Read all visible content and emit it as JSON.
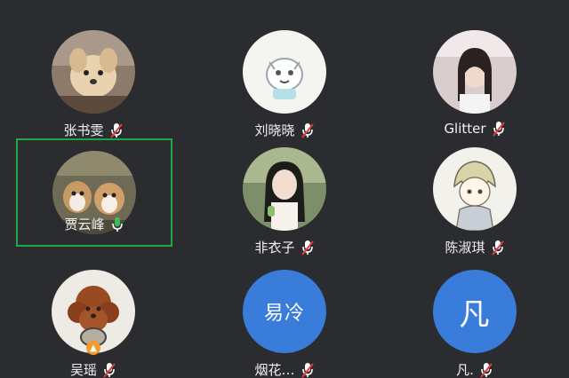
{
  "participants": [
    {
      "name": "张书雯",
      "avatar_icon": "dog-photo-avatar",
      "mic": "muted"
    },
    {
      "name": "刘晓晓",
      "avatar_icon": "cartoon-avatar",
      "mic": "muted"
    },
    {
      "name": "Glitter",
      "avatar_icon": "portrait-photo-avatar",
      "mic": "muted"
    },
    {
      "name": "贾云峰",
      "avatar_icon": "dogs-photo-avatar",
      "mic": "speaking"
    },
    {
      "name": "非衣子",
      "avatar_icon": "portrait-photo-avatar",
      "mic": "muted"
    },
    {
      "name": "陈淑琪",
      "avatar_icon": "anime-avatar",
      "mic": "muted"
    },
    {
      "name": "吴瑶",
      "avatar_icon": "poodle-photo-avatar",
      "mic": "muted"
    },
    {
      "name": "烟花…",
      "avatar_text": "易冷",
      "avatar_icon": "text-avatar",
      "mic": "muted"
    },
    {
      "name": "凡.",
      "avatar_text": "凡",
      "avatar_icon": "text-avatar",
      "mic": "muted"
    }
  ],
  "colors": {
    "background": "#2b2c30",
    "active_border": "#1ea64a",
    "text_avatar_bg": "#3a7cd9",
    "muted_slash": "#e23b3b",
    "speaking_mic": "#35c24f"
  }
}
